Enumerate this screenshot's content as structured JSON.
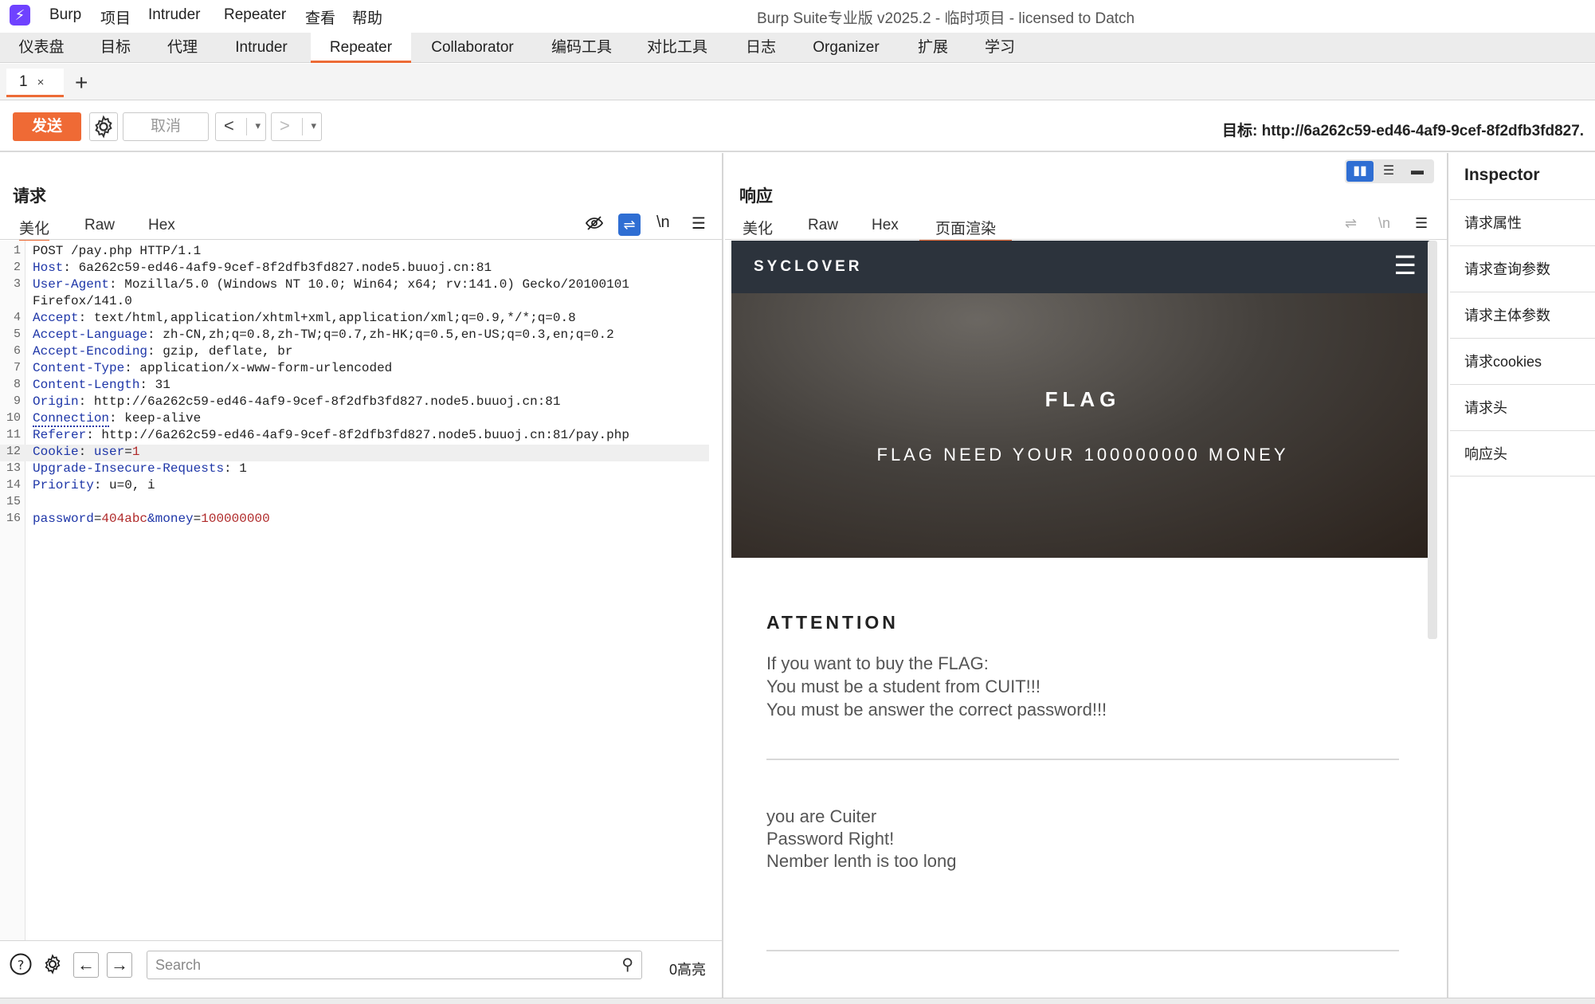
{
  "menu": {
    "app": "Burp",
    "items": [
      "项目",
      "Intruder",
      "Repeater",
      "查看",
      "帮助"
    ],
    "window_title": "Burp Suite专业版  v2025.2 - 临时项目 - licensed to Datch"
  },
  "main_tabs": [
    "仪表盘",
    "目标",
    "代理",
    "Intruder",
    "Repeater",
    "Collaborator",
    "编码工具",
    "对比工具",
    "日志",
    "Organizer",
    "扩展",
    "学习"
  ],
  "repeater_tabs": {
    "active": "1",
    "close": "×",
    "add": "+"
  },
  "toolbar": {
    "send": "发送",
    "cancel": "取消",
    "back": "<",
    "forward": ">",
    "dropdown": "▾",
    "target": "目标: http://6a262c59-ed46-4af9-9cef-8f2dfb3fd827."
  },
  "request": {
    "title": "请求",
    "tabs": [
      "美化",
      "Raw",
      "Hex"
    ],
    "lines": [
      {
        "n": "1",
        "name": "",
        "sep": "",
        "value": "POST /pay.php HTTP/1.1"
      },
      {
        "n": "2",
        "name": "Host",
        "sep": ": ",
        "value": "6a262c59-ed46-4af9-9cef-8f2dfb3fd827.node5.buuoj.cn:81"
      },
      {
        "n": "3",
        "name": "User-Agent",
        "sep": ": ",
        "value": "Mozilla/5.0 (Windows NT 10.0; Win64; x64; rv:141.0) Gecko/20100101"
      },
      {
        "n": "",
        "name": "",
        "sep": "",
        "value": "Firefox/141.0"
      },
      {
        "n": "4",
        "name": "Accept",
        "sep": ": ",
        "value": "text/html,application/xhtml+xml,application/xml;q=0.9,*/*;q=0.8"
      },
      {
        "n": "5",
        "name": "Accept-Language",
        "sep": ": ",
        "value": "zh-CN,zh;q=0.8,zh-TW;q=0.7,zh-HK;q=0.5,en-US;q=0.3,en;q=0.2"
      },
      {
        "n": "6",
        "name": "Accept-Encoding",
        "sep": ": ",
        "value": "gzip, deflate, br"
      },
      {
        "n": "7",
        "name": "Content-Type",
        "sep": ": ",
        "value": "application/x-www-form-urlencoded"
      },
      {
        "n": "8",
        "name": "Content-Length",
        "sep": ": ",
        "value": "31"
      },
      {
        "n": "9",
        "name": "Origin",
        "sep": ": ",
        "value": "http://6a262c59-ed46-4af9-9cef-8f2dfb3fd827.node5.buuoj.cn:81"
      },
      {
        "n": "10",
        "name": "Connection",
        "sep": ": ",
        "value": "keep-alive"
      },
      {
        "n": "11",
        "name": "Referer",
        "sep": ": ",
        "value": "http://6a262c59-ed46-4af9-9cef-8f2dfb3fd827.node5.buuoj.cn:81/pay.php"
      },
      {
        "n": "12",
        "name": "Cookie",
        "sep": ": ",
        "value": "",
        "cookie_name": "user",
        "cookie_eq": "=",
        "cookie_value": "1"
      },
      {
        "n": "13",
        "name": "Upgrade-Insecure-Requests",
        "sep": ": ",
        "value": "1"
      },
      {
        "n": "14",
        "name": "Priority",
        "sep": ": ",
        "value": "u=0, i"
      },
      {
        "n": "15",
        "name": "",
        "sep": "",
        "value": ""
      },
      {
        "n": "16",
        "name": "",
        "sep": "",
        "value": "",
        "body": [
          {
            "k": "password",
            "eq": "=",
            "v": "404abc"
          },
          {
            "k": "&money",
            "eq": "=",
            "v": "100000000"
          }
        ]
      }
    ],
    "footer": {
      "search_placeholder": "Search",
      "highlights": "0高亮"
    }
  },
  "response": {
    "title": "响应",
    "tabs": [
      "美化",
      "Raw",
      "Hex",
      "页面渲染"
    ],
    "rendered": {
      "brand": "SYCLOVER",
      "hero_title": "FLAG",
      "hero_subtitle": "FLAG NEED YOUR 100000000 MONEY",
      "attention": "ATTENTION",
      "lines": [
        "If you want to buy the FLAG:",
        "You must be a student from CUIT!!!",
        "You must be answer the correct password!!!"
      ],
      "result_lines": [
        "you are Cuiter",
        "Password Right!",
        "Nember lenth is too long"
      ]
    }
  },
  "inspector": {
    "title": "Inspector",
    "items": [
      "请求属性",
      "请求查询参数",
      "请求主体参数",
      "请求cookies",
      "请求头",
      "响应头"
    ]
  },
  "icons": {
    "hide": "eye-off-icon",
    "wrap": "word-wrap-icon",
    "newline_label": "\\n",
    "menu": "hamburger-icon"
  }
}
